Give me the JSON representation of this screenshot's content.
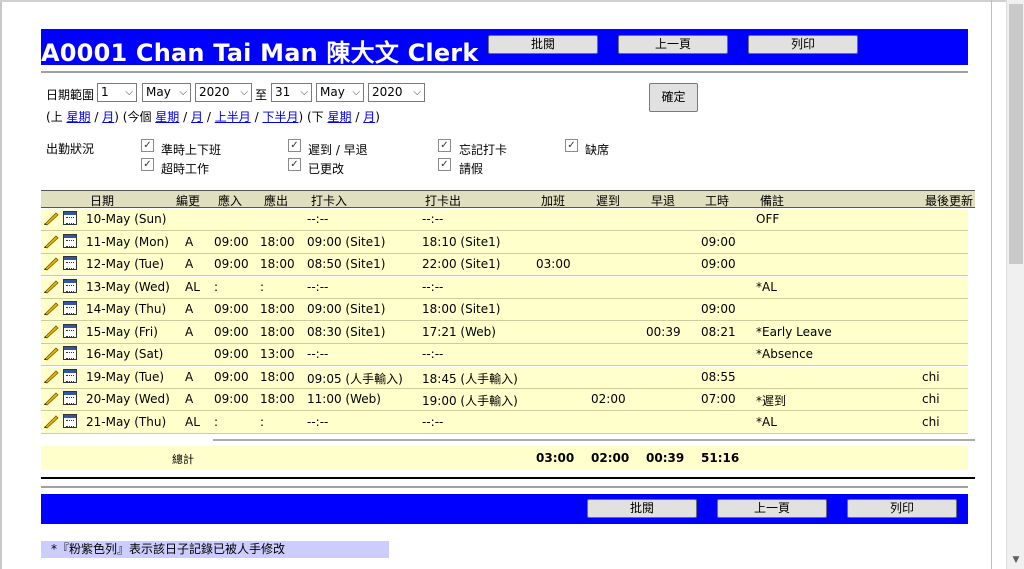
{
  "header": {
    "title": "A0001 Chan Tai Man 陳大文 Clerk",
    "buttons": [
      "批閱",
      "上一頁",
      "列印"
    ]
  },
  "date_range": {
    "label": "日期範圍",
    "from_day": "1",
    "from_month": "May",
    "from_year": "2020",
    "to_label": "至",
    "to_day": "31",
    "to_month": "May",
    "to_year": "2020",
    "confirm": "確定",
    "prev_open": "(上",
    "prev_week": "星期",
    "slash1": "/",
    "prev_month": "月",
    "prev_close": ")",
    "cur_open": "(今個",
    "cur_week": "星期",
    "slash2": "/",
    "cur_month": "月",
    "slash3": "/",
    "first_half": "上半月",
    "slash4": "/",
    "second_half": "下半月",
    "cur_close": ")",
    "next_open": "(下",
    "next_week": "星期",
    "slash5": "/",
    "next_month": "月",
    "next_close": ")"
  },
  "attendance": {
    "label": "出勤狀況",
    "options": [
      {
        "label": "準時上下班",
        "checked": true
      },
      {
        "label": "遲到 / 早退",
        "checked": true
      },
      {
        "label": "忘記打卡",
        "checked": true
      },
      {
        "label": "缺席",
        "checked": true
      },
      {
        "label": "超時工作",
        "checked": true
      },
      {
        "label": "已更改",
        "checked": true
      },
      {
        "label": "請假",
        "checked": true
      }
    ]
  },
  "table": {
    "headers": [
      "日期",
      "編更",
      "應入",
      "應出",
      "打卡入",
      "打卡出",
      "加班",
      "遲到",
      "早退",
      "工時",
      "備註",
      "最後更新"
    ],
    "rows": [
      {
        "date": "10-May (Sun)",
        "shift": "",
        "in": "",
        "out": "",
        "clock_in": "--:--",
        "clock_out": "--:--",
        "ot": "",
        "late": "",
        "early": "",
        "hours": "",
        "remark": "OFF",
        "updated": ""
      },
      {
        "date": "11-May (Mon)",
        "shift": "A",
        "in": "09:00",
        "out": "18:00",
        "clock_in": "09:00 (Site1)",
        "clock_out": "18:10 (Site1)",
        "ot": "",
        "late": "",
        "early": "",
        "hours": "09:00",
        "remark": "",
        "updated": ""
      },
      {
        "date": "12-May (Tue)",
        "shift": "A",
        "in": "09:00",
        "out": "18:00",
        "clock_in": "08:50 (Site1)",
        "clock_out": "22:00 (Site1)",
        "ot": "03:00",
        "late": "",
        "early": "",
        "hours": "09:00",
        "remark": "",
        "updated": ""
      },
      {
        "date": "13-May (Wed)",
        "shift": "AL",
        "in": ":",
        "out": ":",
        "clock_in": "--:--",
        "clock_out": "--:--",
        "ot": "",
        "late": "",
        "early": "",
        "hours": "",
        "remark": "*AL",
        "updated": ""
      },
      {
        "date": "14-May (Thu)",
        "shift": "A",
        "in": "09:00",
        "out": "18:00",
        "clock_in": "09:00 (Site1)",
        "clock_out": "18:00 (Site1)",
        "ot": "",
        "late": "",
        "early": "",
        "hours": "09:00",
        "remark": "",
        "updated": ""
      },
      {
        "date": "15-May (Fri)",
        "shift": "A",
        "in": "09:00",
        "out": "18:00",
        "clock_in": "08:30 (Site1)",
        "clock_out": "17:21 (Web)",
        "ot": "",
        "late": "",
        "early": "00:39",
        "hours": "08:21",
        "remark": "*Early Leave",
        "updated": ""
      },
      {
        "date": "16-May (Sat)",
        "shift": "",
        "in": "09:00",
        "out": "13:00",
        "clock_in": "--:--",
        "clock_out": "--:--",
        "ot": "",
        "late": "",
        "early": "",
        "hours": "",
        "remark": "*Absence",
        "updated": ""
      },
      {
        "date": "19-May (Tue)",
        "shift": "A",
        "in": "09:00",
        "out": "18:00",
        "clock_in": "09:05 (人手輸入)",
        "clock_out": "18:45 (人手輸入)",
        "ot": "",
        "late": "",
        "early": "",
        "hours": "08:55",
        "remark": "",
        "updated": "chi"
      },
      {
        "date": "20-May (Wed)",
        "shift": "A",
        "in": "09:00",
        "out": "18:00",
        "clock_in": "11:00 (Web)",
        "clock_out": "19:00 (人手輸入)",
        "ot": "",
        "late": "02:00",
        "early": "",
        "hours": "07:00",
        "remark": "*遲到",
        "updated": "chi"
      },
      {
        "date": "21-May (Thu)",
        "shift": "AL",
        "in": ":",
        "out": ":",
        "clock_in": "--:--",
        "clock_out": "--:--",
        "ot": "",
        "late": "",
        "early": "",
        "hours": "",
        "remark": "*AL",
        "updated": "chi"
      }
    ],
    "total": {
      "label": "總計",
      "ot": "03:00",
      "late": "02:00",
      "early": "00:39",
      "hours": "51:16"
    }
  },
  "footer": {
    "buttons": [
      "批閱",
      "上一頁",
      "列印"
    ],
    "note": "*『粉紫色列』表示該日子記錄已被人手修改"
  },
  "colors": {
    "header_blue": "#0000ff",
    "row_yellow": "#ffffcc",
    "note_lilac": "#ccccff"
  }
}
